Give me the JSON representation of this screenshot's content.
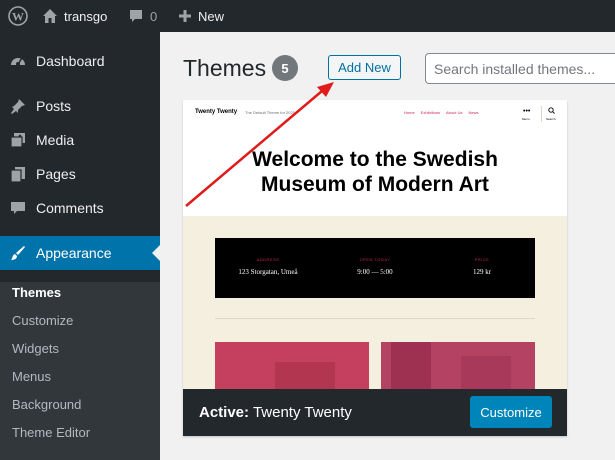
{
  "adminbar": {
    "site_name": "transgo",
    "comments_count": "0",
    "new_label": "New"
  },
  "sidebar": {
    "items": [
      {
        "label": "Dashboard",
        "icon": "dashboard-icon"
      },
      {
        "label": "Posts",
        "icon": "pin-icon"
      },
      {
        "label": "Media",
        "icon": "media-icon"
      },
      {
        "label": "Pages",
        "icon": "pages-icon"
      },
      {
        "label": "Comments",
        "icon": "comment-icon"
      },
      {
        "label": "Appearance",
        "icon": "brush-icon"
      }
    ],
    "submenu": [
      "Themes",
      "Customize",
      "Widgets",
      "Menus",
      "Background",
      "Theme Editor"
    ]
  },
  "main": {
    "title": "Themes",
    "count": "5",
    "add_new_label": "Add New",
    "search_placeholder": "Search installed themes..."
  },
  "theme": {
    "site_title": "Twenty Twenty",
    "site_description": "The Default Theme for 2020",
    "nav": [
      "Home",
      "Exhibitions",
      "About Us",
      "News"
    ],
    "menu_label": "Menu",
    "search_label": "Search",
    "headline": "Welcome to the Swedish Museum of Modern Art",
    "info": [
      {
        "label": "ADDRESS",
        "value": "123 Storgatan, Umeå"
      },
      {
        "label": "OPEN TODAY",
        "value": "9:00 — 5:00"
      },
      {
        "label": "PRICE",
        "value": "129 kr"
      }
    ],
    "active_prefix": "Active:",
    "active_name": "Twenty Twenty",
    "customize_label": "Customize"
  },
  "colors": {
    "accent": "#0073aa",
    "admin_dark": "#23282d",
    "annotation_arrow": "#e11b1b"
  }
}
